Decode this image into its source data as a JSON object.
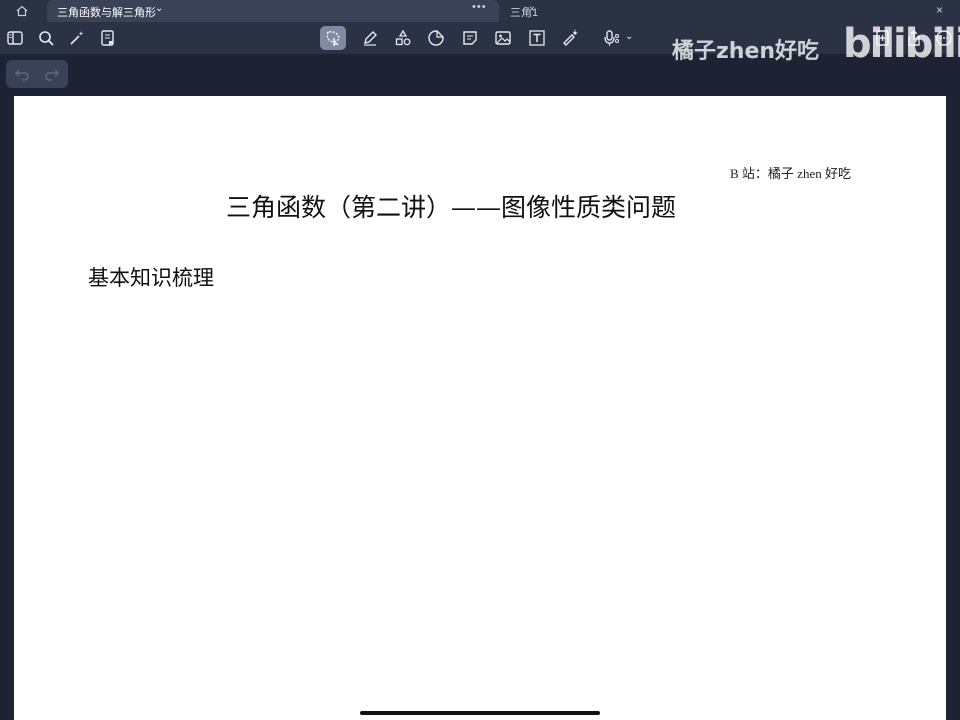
{
  "tabs": {
    "active_title": "三角函数与解三角形",
    "active_chevron": "⌄",
    "more_dots": "•••",
    "inactive_title": "三角1",
    "close_glyph": "×"
  },
  "toolbar": {
    "left_icons": [
      "sidebar-icon",
      "search-icon",
      "magic-wand-icon",
      "document-bookmark-icon"
    ],
    "center_icons": [
      "lasso-icon",
      "pen-icon",
      "shapes-icon",
      "sticker-icon",
      "sticky-note-icon",
      "image-icon",
      "text-box-icon",
      "laser-pointer-icon",
      "microphone-icon"
    ],
    "right_icons": [
      "add-page-icon",
      "share-icon",
      "more-icon"
    ],
    "active_tool": "lasso-icon",
    "active_color": "#7f8aa3"
  },
  "watermark": {
    "text": "橘子zhen好吃",
    "logo": "bilibili"
  },
  "page": {
    "credit": "B 站：橘子 zhen 好吃",
    "title": "三角函数（第二讲）——图像性质类问题",
    "heading": "基本知识梳理"
  }
}
